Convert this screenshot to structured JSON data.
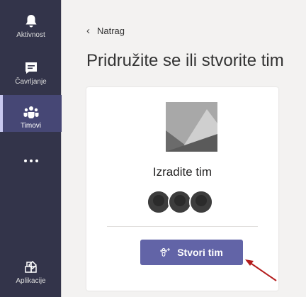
{
  "rail": {
    "items": [
      {
        "label": "Aktivnost",
        "icon": "bell-icon"
      },
      {
        "label": "Čavrljanje",
        "icon": "chat-icon"
      },
      {
        "label": "Timovi",
        "icon": "teams-icon"
      },
      {
        "label": "",
        "icon": "more-icon"
      },
      {
        "label": "Aplikacije",
        "icon": "apps-icon"
      }
    ],
    "active_index": 2
  },
  "main": {
    "back_label": "Natrag",
    "title": "Pridružite se ili stvorite tim",
    "card": {
      "title": "Izradite tim",
      "button_label": "Stvori tim"
    }
  },
  "colors": {
    "rail_bg": "#33344a",
    "rail_active": "#464775",
    "accent": "#6264a7",
    "annotation_arrow": "#b31b1b"
  }
}
